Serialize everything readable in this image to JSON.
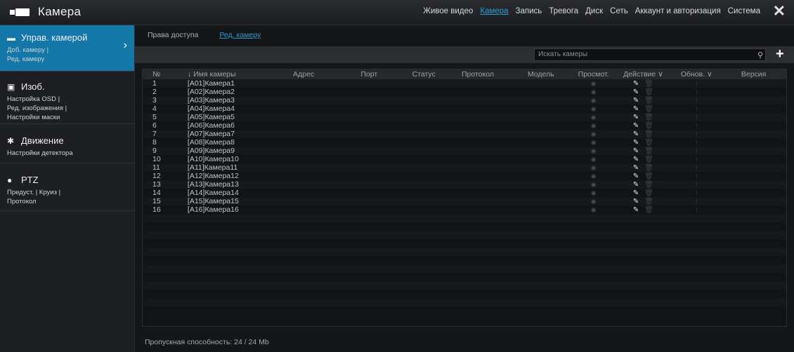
{
  "app": {
    "title": "Камера"
  },
  "nav": {
    "items": [
      "Живое видео",
      "Камера",
      "Запись",
      "Тревога",
      "Диск",
      "Сеть",
      "Аккаунт и авторизация",
      "Система"
    ],
    "active": "Камера"
  },
  "sidebar": {
    "sections": [
      {
        "title": "Управ. камерой",
        "sub": [
          "Доб. камеру |",
          "Ред. камеру"
        ],
        "icon": "camera-icon",
        "active": true
      },
      {
        "title": "Изоб.",
        "sub": [
          "Настройка OSD |",
          "Ред. изображения |",
          "Настройки маски"
        ],
        "icon": "image-icon",
        "active": false
      },
      {
        "title": "Движение",
        "sub": [
          "Настройки детектора"
        ],
        "icon": "motion-icon",
        "active": false
      },
      {
        "title": "PTZ",
        "sub": [
          "Предуст. | Круиз |",
          "Протокол"
        ],
        "icon": "ptz-icon",
        "active": false
      }
    ]
  },
  "subtabs": {
    "access": "Права доступа",
    "edit": "Ред. камеру"
  },
  "search": {
    "placeholder": "Искать камеры"
  },
  "table": {
    "headers": {
      "no": "№",
      "name": "Имя камеры",
      "address": "Адрес",
      "port": "Порт",
      "status": "Статус",
      "protocol": "Протокол",
      "model": "Модель",
      "view": "Просмот.",
      "action": "Действие ∨",
      "update": "Обнов. ∨",
      "version": "Версия"
    },
    "rows": [
      {
        "no": "1",
        "name": "[A01]Камера1"
      },
      {
        "no": "2",
        "name": "[A02]Камера2"
      },
      {
        "no": "3",
        "name": "[A03]Камера3"
      },
      {
        "no": "4",
        "name": "[A04]Камера4"
      },
      {
        "no": "5",
        "name": "[A05]Камера5"
      },
      {
        "no": "6",
        "name": "[A06]Камера6"
      },
      {
        "no": "7",
        "name": "[A07]Камера7"
      },
      {
        "no": "8",
        "name": "[A08]Камера8"
      },
      {
        "no": "9",
        "name": "[A09]Камера9"
      },
      {
        "no": "10",
        "name": "[A10]Камера10"
      },
      {
        "no": "11",
        "name": "[A11]Камера11"
      },
      {
        "no": "12",
        "name": "[A12]Камера12"
      },
      {
        "no": "13",
        "name": "[A13]Камера13"
      },
      {
        "no": "14",
        "name": "[A14]Камера14"
      },
      {
        "no": "15",
        "name": "[A15]Камера15"
      },
      {
        "no": "16",
        "name": "[A16]Камера16"
      }
    ]
  },
  "footer": {
    "bandwidth": "Пропускная способность: 24 / 24 Mb"
  },
  "colors": {
    "accent": "#2e9bd6",
    "sidebar_active": "#1378a8",
    "background": "#151618"
  }
}
